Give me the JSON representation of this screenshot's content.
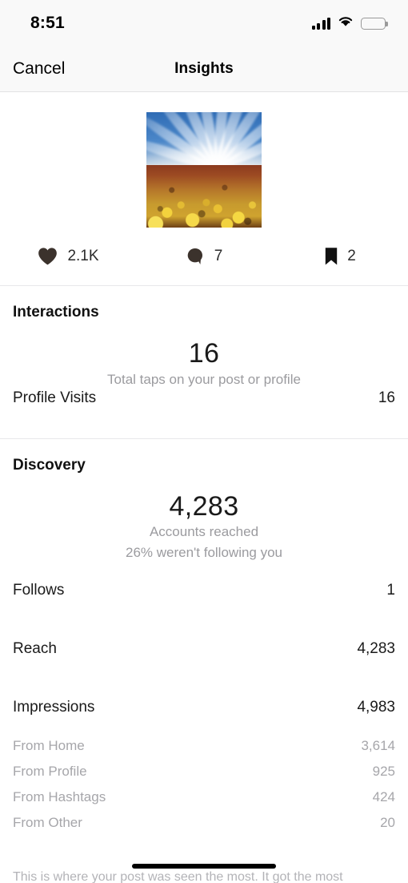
{
  "status_bar": {
    "time": "8:51",
    "signal_icon": "cellular-signal-icon",
    "wifi_icon": "wifi-icon",
    "battery_icon": "battery-full-icon"
  },
  "nav_bar": {
    "cancel_label": "Cancel",
    "title": "Insights"
  },
  "post": {
    "thumbnail_alt": "field of yellow flowers under blue sky with radiating clouds"
  },
  "engagement": [
    {
      "icon": "heart-icon",
      "value": "2.1K"
    },
    {
      "icon": "comment-icon",
      "value": "7"
    },
    {
      "icon": "bookmark-icon",
      "value": "2"
    }
  ],
  "interactions": {
    "title": "Interactions",
    "big_number": "16",
    "caption": "Total taps on your post or profile",
    "rows": [
      {
        "label": "Profile Visits",
        "value": "16"
      }
    ]
  },
  "discovery": {
    "title": "Discovery",
    "big_number": "4,283",
    "caption_line1": "Accounts reached",
    "caption_line2": "26% weren't following you",
    "rows": [
      {
        "label": "Follows",
        "value": "1"
      },
      {
        "label": "Reach",
        "value": "4,283"
      },
      {
        "label": "Impressions",
        "value": "4,983"
      }
    ],
    "impression_breakdown": [
      {
        "label": "From Home",
        "value": "3,614"
      },
      {
        "label": "From Profile",
        "value": "925"
      },
      {
        "label": "From Hashtags",
        "value": "424"
      },
      {
        "label": "From Other",
        "value": "20"
      }
    ]
  },
  "footer_note": "This is where your post was seen the most. It got the most",
  "colors": {
    "background": "#ffffff",
    "bar_background": "#f9f9f9",
    "divider": "#e8e8ea",
    "primary_text": "#1a1a1a",
    "secondary_text": "#a6a6aa"
  }
}
